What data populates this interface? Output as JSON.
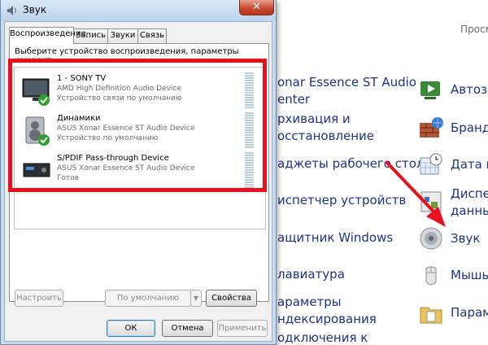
{
  "dialog": {
    "title": "Звук",
    "close_glyph": "✕",
    "tabs": [
      {
        "label": "Воспроизведение",
        "active": true
      },
      {
        "label": "Запись",
        "active": false
      },
      {
        "label": "Звуки",
        "active": false
      },
      {
        "label": "Связь",
        "active": false
      }
    ],
    "description": "Выберите устройство воспроизведения, параметры которого нужно",
    "description_cut": "изменить:",
    "devices": [
      {
        "name": "1 - SONY TV",
        "driver": "AMD High Definition Audio Device",
        "status": "Устройство связи по умолчанию",
        "icon": "tv-icon",
        "badge": "phone-check-badge"
      },
      {
        "name": "Динамики",
        "driver": "ASUS Xonar Essence ST Audio Device",
        "status": "Устройство по умолчанию",
        "icon": "speaker-icon",
        "badge": "green-check-badge"
      },
      {
        "name": "S/PDIF Pass-through Device",
        "driver": "ASUS Xonar Essence ST Audio Device",
        "status": "Готов",
        "icon": "spdif-device-icon",
        "badge": ""
      }
    ],
    "buttons": {
      "configure": "Настроить",
      "set_default": "По умолчанию",
      "properties": "Свойства",
      "ok": "ОК",
      "cancel": "Отмена",
      "apply": "Применить"
    }
  },
  "control_panel": {
    "search_hint": "Просм",
    "left_column": [
      {
        "text": "onar Essence ST Audio"
      },
      {
        "text": "enter"
      },
      {
        "text": "рхивация и"
      },
      {
        "text": "осстановление"
      },
      {
        "text": "аджеты рабочего стола"
      },
      {
        "text": "испетчер устройств"
      },
      {
        "text": "ащитник Windows"
      },
      {
        "text": "лавиатура"
      },
      {
        "text": "араметры"
      },
      {
        "text": "ндексирования"
      },
      {
        "text": "одключения к"
      }
    ],
    "right_column": [
      {
        "text": "Автоза",
        "icon": "autoplay-icon"
      },
      {
        "text": "Брандм",
        "icon": "firewall-icon"
      },
      {
        "text": "Дата и",
        "icon": "date-time-icon"
      },
      {
        "text": "Диспет",
        "icon": "task-manager-icon"
      },
      {
        "text": "данны",
        "icon": ""
      },
      {
        "text": "Звук",
        "icon": "sound-icon"
      },
      {
        "text": "Мышь",
        "icon": "mouse-icon"
      },
      {
        "text": "Парам",
        "icon": "folder-options-icon"
      }
    ]
  },
  "colors": {
    "highlight": "#e8101c",
    "link": "#1e3287"
  }
}
